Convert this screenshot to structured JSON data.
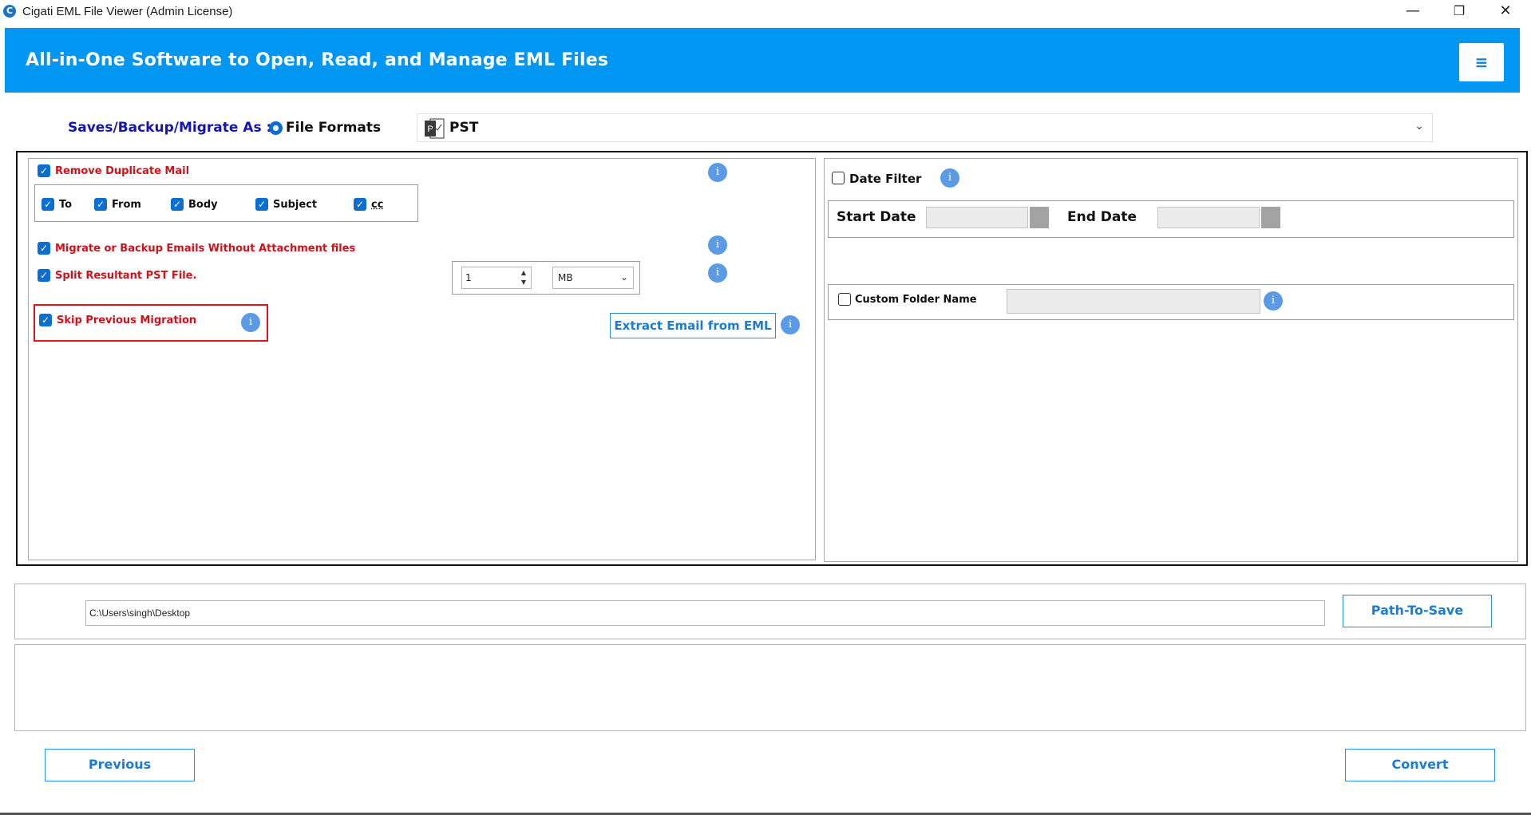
{
  "window": {
    "title": "Cigati EML File Viewer (Admin License)",
    "icon_letter": "C",
    "minimize": "—",
    "maximize": "❐",
    "close": "✕"
  },
  "header": {
    "title": "All-in-One Software to Open, Read, and Manage EML Files",
    "menu_icon": "≡"
  },
  "saves": {
    "label": "Saves/Backup/Migrate As :",
    "radio_label": "File Formats",
    "format_selected": "PST",
    "format_icon": "pst-file-icon"
  },
  "options": {
    "remove_duplicate": {
      "label": "Remove Duplicate Mail",
      "checked": true
    },
    "duplicate_fields": [
      {
        "label": "To",
        "checked": true
      },
      {
        "label": "From",
        "checked": true
      },
      {
        "label": "Body",
        "checked": true
      },
      {
        "label": "Subject",
        "checked": true
      },
      {
        "label": "cc",
        "checked": true
      }
    ],
    "without_attachment": {
      "label": "Migrate or Backup Emails Without Attachment files",
      "checked": true
    },
    "split_pst": {
      "label": "Split Resultant PST File.",
      "checked": true,
      "size_value": "1",
      "size_unit": "MB"
    },
    "skip_previous": {
      "label": "Skip Previous Migration",
      "checked": true
    },
    "extract_button": "Extract Email from EML",
    "info_glyph": "i"
  },
  "filters": {
    "date_filter": {
      "label": "Date Filter",
      "checked": false
    },
    "start_date_label": "Start Date",
    "end_date_label": "End Date",
    "custom_folder": {
      "label": "Custom Folder Name",
      "checked": false
    }
  },
  "path": {
    "value": "C:\\Users\\singh\\Desktop",
    "button": "Path-To-Save"
  },
  "footer": {
    "previous": "Previous",
    "convert": "Convert"
  },
  "colors": {
    "header_bg": "#0096f2",
    "label_red": "#d0121b",
    "label_blue": "#1515b3",
    "button_blue": "#1b7cd0",
    "highlight_red": "#e0141c"
  }
}
